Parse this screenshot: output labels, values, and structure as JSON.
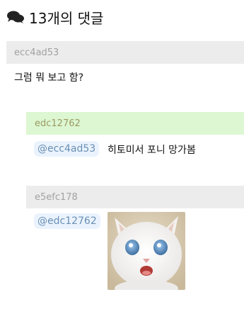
{
  "header": {
    "icon": "comments-icon",
    "title": "13개의 댓글"
  },
  "comments": [
    {
      "author": "ecc4ad53",
      "text": "그럼 뭐 보고 함?"
    },
    {
      "author": "edc12762",
      "mention": "@ecc4ad53",
      "text": "히토미서 포니 망가봄"
    },
    {
      "author": "e5efc178",
      "mention": "@edc12762",
      "image": "cat-photo"
    }
  ],
  "colors": {
    "gray_bar": "#ececec",
    "green_bar": "#dcf7d2",
    "mention_bg": "#eaf3fd",
    "mention_text": "#6a8fb4"
  }
}
